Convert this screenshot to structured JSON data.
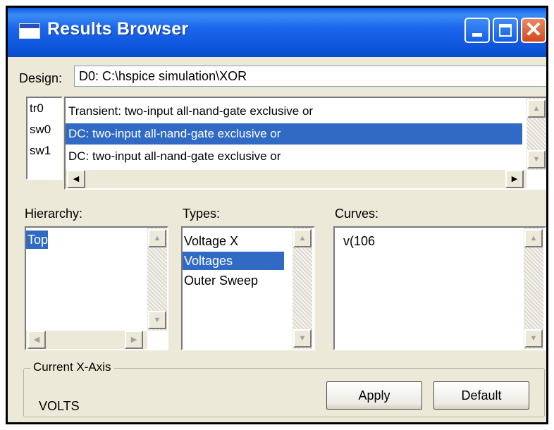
{
  "window": {
    "title": "Results Browser"
  },
  "design": {
    "label": "Design:",
    "value": "D0: C:\\hspice simulation\\XOR"
  },
  "results": [
    {
      "id": "tr0",
      "text": "Transient: two-input all-nand-gate exclusive or",
      "selected": false
    },
    {
      "id": "sw0",
      "text": "DC: two-input all-nand-gate exclusive or",
      "selected": true
    },
    {
      "id": "sw1",
      "text": "DC: two-input all-nand-gate exclusive or",
      "selected": false
    }
  ],
  "hierarchy": {
    "label": "Hierarchy:",
    "items": [
      "Top"
    ],
    "selected": "Top"
  },
  "types": {
    "label": "Types:",
    "items": [
      "Voltage X",
      "Voltages",
      "Outer Sweep"
    ],
    "selected": "Voltages"
  },
  "curves": {
    "label": "Curves:",
    "items": [
      "v(106"
    ]
  },
  "xaxis": {
    "group_label": "Current X-Axis",
    "value": "VOLTS"
  },
  "buttons": {
    "apply": "Apply",
    "default": "Default"
  },
  "colors": {
    "titlebar": "#0b53d8",
    "selection": "#316ac5",
    "face": "#ece9d8"
  },
  "icons": [
    "window-icon",
    "minimize-icon",
    "maximize-icon",
    "close-icon",
    "scroll-up-icon",
    "scroll-down-icon",
    "scroll-left-icon",
    "scroll-right-icon"
  ]
}
